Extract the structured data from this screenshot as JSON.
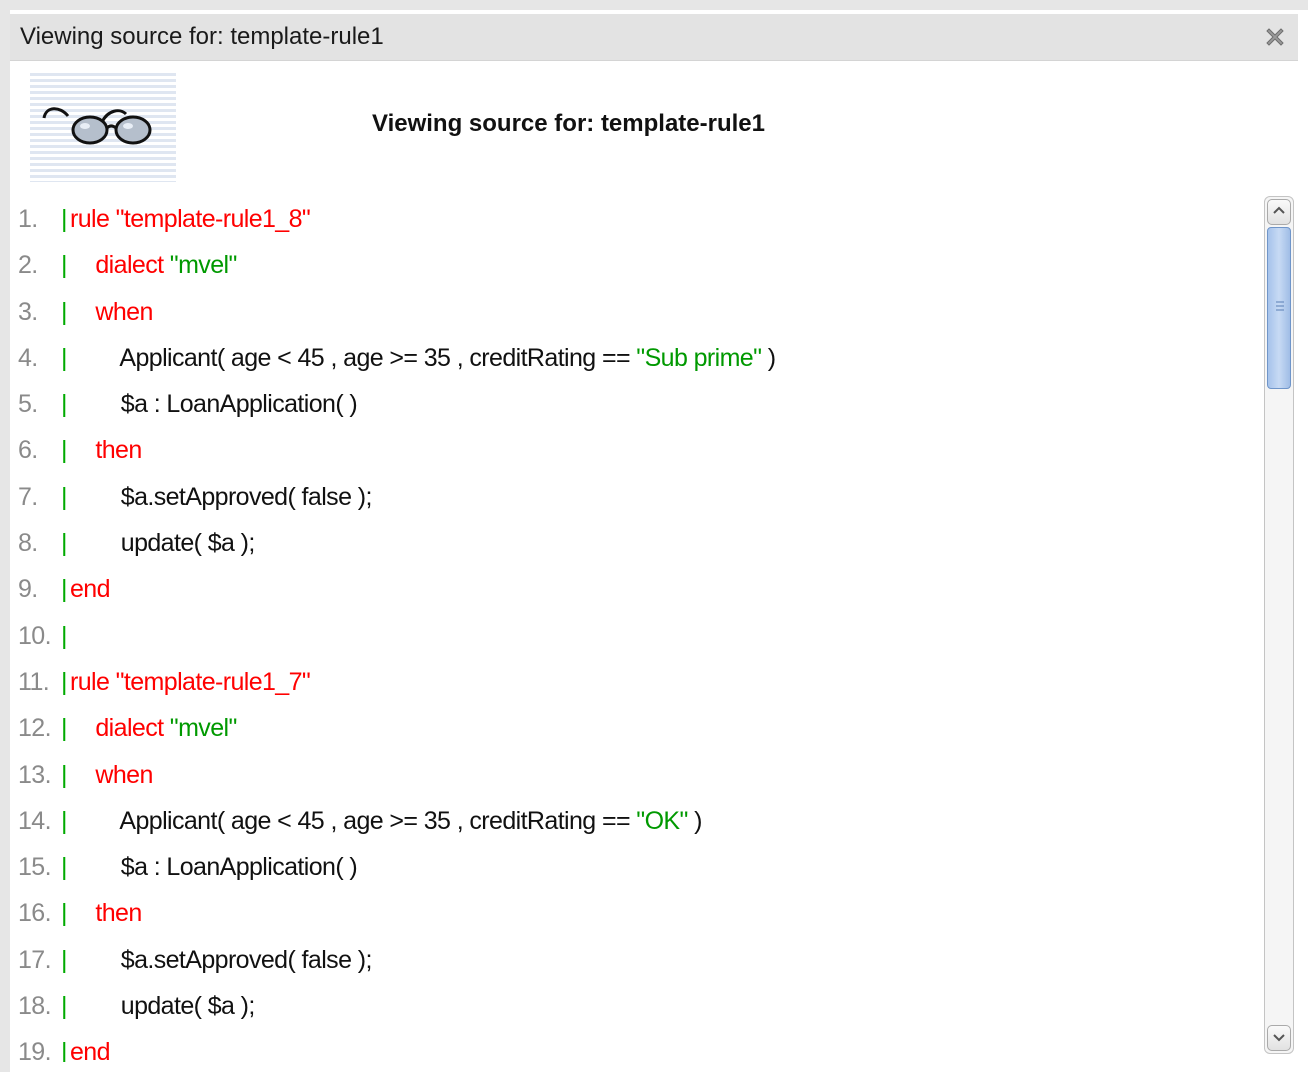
{
  "dialog": {
    "title": "Viewing source for: template-rule1",
    "close_icon": "close-x-icon"
  },
  "header": {
    "icon": "glasses-icon",
    "title": "Viewing source for: template-rule1"
  },
  "code_lines": [
    {
      "num": "1.",
      "bar": "|",
      "parts": [
        {
          "t": "rule \"template-rule1_8\"",
          "c": "kw"
        }
      ]
    },
    {
      "num": "2.",
      "bar": "|",
      "parts": [
        {
          "t": "    dialect ",
          "c": "kw"
        },
        {
          "t": "\"mvel\"",
          "c": "str"
        }
      ]
    },
    {
      "num": "3.",
      "bar": "|",
      "parts": [
        {
          "t": "    when",
          "c": "kw"
        }
      ]
    },
    {
      "num": "4.",
      "bar": "|",
      "parts": [
        {
          "t": "        Applicant( age < 45 , age >= 35 , creditRating == ",
          "c": "plain"
        },
        {
          "t": "\"Sub prime\"",
          "c": "str"
        },
        {
          "t": " )",
          "c": "plain"
        }
      ]
    },
    {
      "num": "5.",
      "bar": "|",
      "parts": [
        {
          "t": "        $a : LoanApplication( )",
          "c": "plain"
        }
      ]
    },
    {
      "num": "6.",
      "bar": "|",
      "parts": [
        {
          "t": "    then",
          "c": "kw"
        }
      ]
    },
    {
      "num": "7.",
      "bar": "|",
      "parts": [
        {
          "t": "        $a.setApproved( false );",
          "c": "plain"
        }
      ]
    },
    {
      "num": "8.",
      "bar": "|",
      "parts": [
        {
          "t": "        update( $a );",
          "c": "plain"
        }
      ]
    },
    {
      "num": "9.",
      "bar": "|",
      "parts": [
        {
          "t": "end",
          "c": "kw"
        }
      ]
    },
    {
      "num": "10.",
      "bar": "|",
      "parts": []
    },
    {
      "num": "11.",
      "bar": "|",
      "parts": [
        {
          "t": "rule \"template-rule1_7\"",
          "c": "kw"
        }
      ]
    },
    {
      "num": "12.",
      "bar": "|",
      "parts": [
        {
          "t": "    dialect ",
          "c": "kw"
        },
        {
          "t": "\"mvel\"",
          "c": "str"
        }
      ]
    },
    {
      "num": "13.",
      "bar": "|",
      "parts": [
        {
          "t": "    when",
          "c": "kw"
        }
      ]
    },
    {
      "num": "14.",
      "bar": "|",
      "parts": [
        {
          "t": "        Applicant( age < 45 , age >= 35 , creditRating == ",
          "c": "plain"
        },
        {
          "t": "\"OK\"",
          "c": "str"
        },
        {
          "t": " )",
          "c": "plain"
        }
      ]
    },
    {
      "num": "15.",
      "bar": "|",
      "parts": [
        {
          "t": "        $a : LoanApplication( )",
          "c": "plain"
        }
      ]
    },
    {
      "num": "16.",
      "bar": "|",
      "parts": [
        {
          "t": "    then",
          "c": "kw"
        }
      ]
    },
    {
      "num": "17.",
      "bar": "|",
      "parts": [
        {
          "t": "        $a.setApproved( false );",
          "c": "plain"
        }
      ]
    },
    {
      "num": "18.",
      "bar": "|",
      "parts": [
        {
          "t": "        update( $a );",
          "c": "plain"
        }
      ]
    },
    {
      "num": "19.",
      "bar": "|",
      "parts": [
        {
          "t": "end",
          "c": "kw"
        }
      ]
    }
  ],
  "scrollbar": {
    "up_icon": "chevron-up-icon",
    "down_icon": "chevron-down-icon",
    "thumb_grip_icon": "grip-lines-icon",
    "position_fraction": 0.0
  },
  "colors": {
    "keyword": "#ff0000",
    "string": "#009900",
    "gutter_bar": "#00aa00",
    "line_number": "#8a8a8a",
    "title_bar": "#e3e3e3"
  }
}
